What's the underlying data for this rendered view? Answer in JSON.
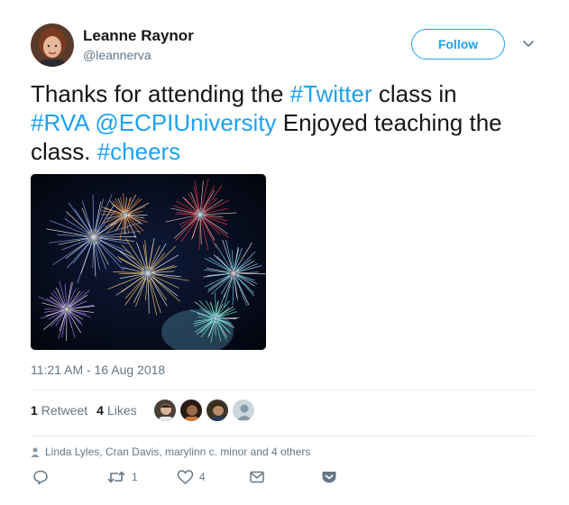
{
  "user": {
    "name": "Leanne Raynor",
    "handle": "@leannerva",
    "follow_label": "Follow"
  },
  "tweet": {
    "text_1": "Thanks for attending the ",
    "hashtag_twitter": "#Twitter",
    "text_2": " class in ",
    "hashtag_rva": "#RVA",
    "mention_ecpi": "@ECPIUniversity",
    "text_3": "  Enjoyed teaching the class. ",
    "hashtag_cheers": "#cheers",
    "timestamp": "11:21 AM - 16 Aug 2018"
  },
  "stats": {
    "retweets_count": "1",
    "retweets_label": "Retweet",
    "likes_count": "4",
    "likes_label": "Likes"
  },
  "liked_by": "Linda Lyles, Cran Davis, marylinn c. minor and 4 others",
  "actions": {
    "reply_icon": "reply-icon",
    "retweet_icon": "retweet-icon",
    "retweet_count": "1",
    "like_icon": "heart-icon",
    "like_count": "4",
    "message_icon": "envelope-icon",
    "pocket_icon": "pocket-icon"
  },
  "colors": {
    "accent": "#1da1f2",
    "text": "#14171a",
    "muted": "#657786",
    "divider": "#e6ecf0"
  }
}
